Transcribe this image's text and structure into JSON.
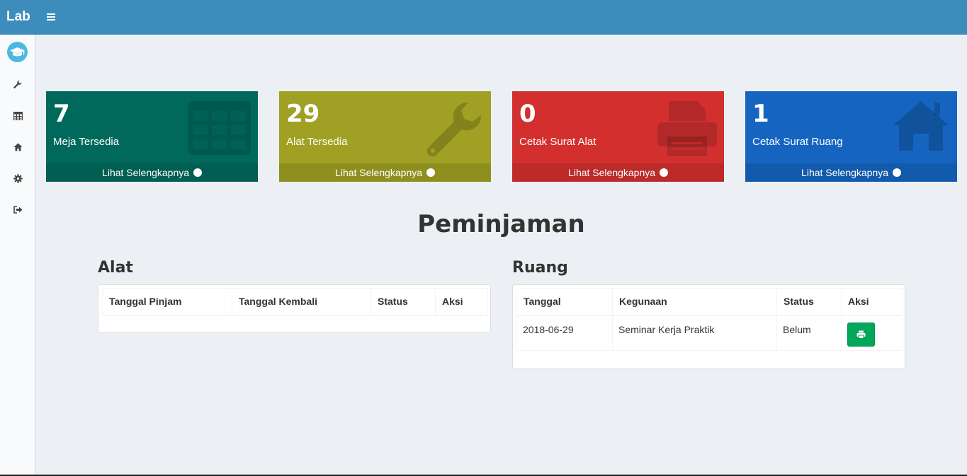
{
  "app": {
    "brand": "Lab"
  },
  "icons": {
    "menu": "hamburger-icon",
    "logo": "graduation-cap-icon",
    "sidebar": [
      "wrench-icon",
      "table-icon",
      "home-icon",
      "gear-icon",
      "sign-out-icon"
    ]
  },
  "boxes": [
    {
      "value": "7",
      "label": "Meja Tersedia",
      "link": "Lihat Selengkapnya",
      "color": "#00695c",
      "icon": "table-icon"
    },
    {
      "value": "29",
      "label": "Alat Tersedia",
      "link": "Lihat Selengkapnya",
      "color": "#a0a024",
      "icon": "wrench-icon"
    },
    {
      "value": "0",
      "label": "Cetak Surat Alat",
      "link": "Lihat Selengkapnya",
      "color": "#d32f2f",
      "icon": "print-icon"
    },
    {
      "value": "1",
      "label": "Cetak Surat Ruang",
      "link": "Lihat Selengkapnya",
      "color": "#1565c0",
      "icon": "home-icon"
    }
  ],
  "section": {
    "title": "Peminjaman"
  },
  "alat": {
    "title": "Alat",
    "columns": [
      "Tanggal Pinjam",
      "Tanggal Kembali",
      "Status",
      "Aksi"
    ],
    "rows": []
  },
  "ruang": {
    "title": "Ruang",
    "columns": [
      "Tanggal",
      "Kegunaan",
      "Status",
      "Aksi"
    ],
    "rows": [
      {
        "tanggal": "2018-06-29",
        "kegunaan": "Seminar Kerja Praktik",
        "status": "Belum",
        "aksi_icon": "print-icon"
      }
    ]
  }
}
